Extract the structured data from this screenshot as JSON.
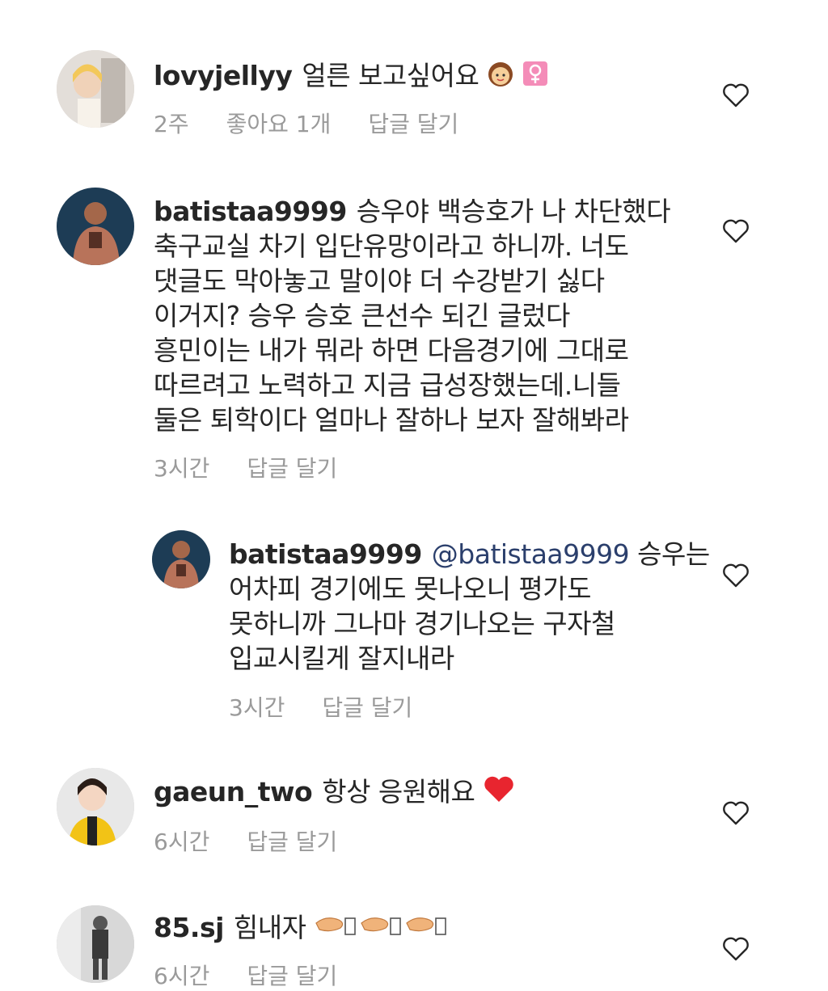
{
  "comments": [
    {
      "username": "lovyjellyy",
      "text": "얼른 보고싶어요",
      "emoji": [
        "woman-emoji",
        "female-sign-emoji"
      ],
      "time": "2주",
      "likes": "좋아요 1개",
      "reply": "답글 달기"
    },
    {
      "username": "batistaa9999",
      "lines": [
        "승우야 백승호가 나 차단했다",
        "축구교실 차기 입단유망이라고 하니까. 너도",
        "댓글도 막아놓고 말이야 더 수강받기 싫다",
        "이거지? 승우 승호 큰선수 되긴 글렀다",
        "흥민이는 내가 뭐라 하면 다음경기에 그대로",
        "따르려고 노력하고 지금 급성장했는데.니들",
        "둘은 퇴학이다 얼마나 잘하나 보자 잘해봐라"
      ],
      "time": "3시간",
      "reply": "답글 달기"
    },
    {
      "username": "batistaa9999",
      "mention": "@batistaa9999",
      "lines": [
        "승우는",
        "어차피 경기에도 못나오니 평가도",
        "못하니까 그나마 경기나오는 구자철",
        "입교시킬게 잘지내라"
      ],
      "time": "3시간",
      "reply": "답글 달기"
    },
    {
      "username": "gaeun_two",
      "text": "항상 응원해요",
      "emoji": [
        "red-heart-emoji"
      ],
      "time": "6시간",
      "reply": "답글 달기"
    },
    {
      "username": "85.sj",
      "text": "힘내자",
      "emoji": [
        "clapping-hands-emoji"
      ],
      "time": "6시간",
      "reply": "답글 달기"
    }
  ]
}
